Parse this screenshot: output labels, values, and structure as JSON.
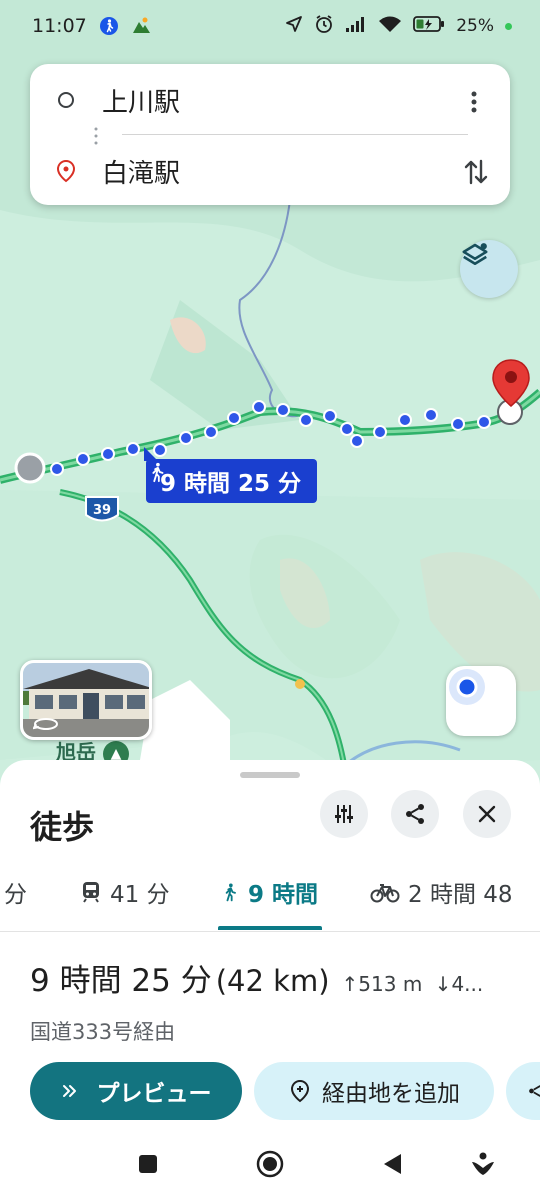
{
  "status_bar": {
    "time": "11:07",
    "battery": "25%",
    "left_icons": [
      "walking-notification-icon",
      "hiking-app-icon"
    ],
    "right_icons": [
      "location-arrow-icon",
      "alarm-icon",
      "signal-icon",
      "wifi-icon",
      "battery-icon"
    ]
  },
  "search": {
    "origin": "上川駅",
    "destination": "白滝駅",
    "menu_icon": "more-vert-icon",
    "swap_icon": "swap-vert-icon"
  },
  "map": {
    "route_label": "9 時間 25 分",
    "route_color": "#1a3fcf",
    "road_shield": "39",
    "place_label": "旭岳",
    "layers_icon": "layers-icon",
    "locate_icon": "my-location-icon"
  },
  "sheet": {
    "title": "徒歩",
    "buttons": [
      "tune-icon",
      "share-icon",
      "close-icon"
    ],
    "tabs": [
      {
        "label": "分",
        "icon": ""
      },
      {
        "label": "41 分",
        "icon": "train-icon"
      },
      {
        "label": "9 時間",
        "icon": "walk-icon",
        "active": true
      },
      {
        "label": "2 時間 48",
        "icon": "bicycle-icon"
      }
    ],
    "summary": {
      "duration": "9 時間 25 分",
      "distance": "(42 km)",
      "ascent": "513 m",
      "descent": "4..."
    },
    "via": "国道333号経由",
    "preview_label": "プレビュー",
    "add_stop_label": "経由地を追加",
    "accent": "#137480"
  },
  "nav": [
    "recents-square-icon",
    "home-circle-icon",
    "back-triangle-icon",
    "assistant-icon"
  ]
}
